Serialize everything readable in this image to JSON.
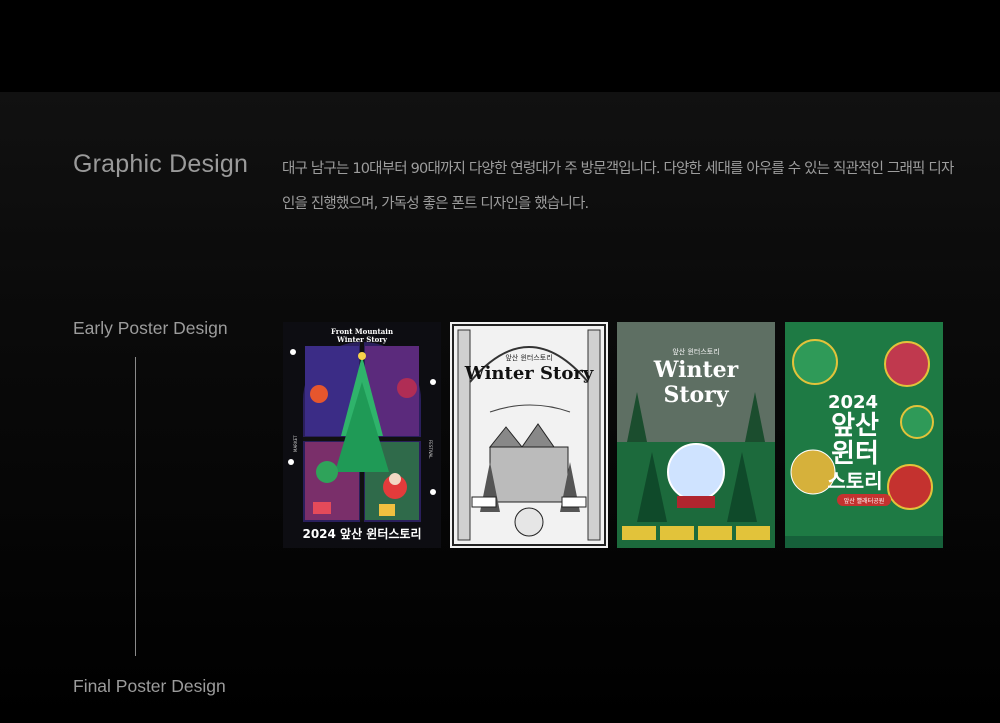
{
  "section": {
    "title": "Graphic Design",
    "description": "대구 남구는 10대부터 90대까지 다양한 연령대가  주 방문객입니다. 다양한 세대를 아우를 수 있는 직관적인 그래픽 디자인을 진행했으며, 가독성 좋은 폰트 디자인을 했습니다."
  },
  "timeline": {
    "start_label": "Early Poster Design",
    "end_label": "Final Poster Design"
  },
  "posters": [
    {
      "header": "Front Mountain",
      "header2": "Winter Story",
      "footer": "2024 앞산 윈터스토리",
      "side_left": "MARKET",
      "side_right": "FESTIVAL",
      "theme": "dark-stained-glass"
    },
    {
      "kicker": "앞산 윈터스토리",
      "title": "Winter Story",
      "theme": "black-and-white-illustration"
    },
    {
      "kicker": "앞산 윈터스토리",
      "title1": "Winter",
      "title2": "Story",
      "theme": "green-snow-globe"
    },
    {
      "year": "2024",
      "line1": "앞산",
      "line2": "윈터",
      "line3": "스토리",
      "badge": "앞산 빨래터공원",
      "theme": "green-ornaments"
    }
  ],
  "colors": {
    "background": "#000000",
    "panel": "#0f0f0f",
    "text": "#9d9d9d",
    "poster_green": "#1e7a44",
    "poster_gold": "#e2c33a"
  }
}
